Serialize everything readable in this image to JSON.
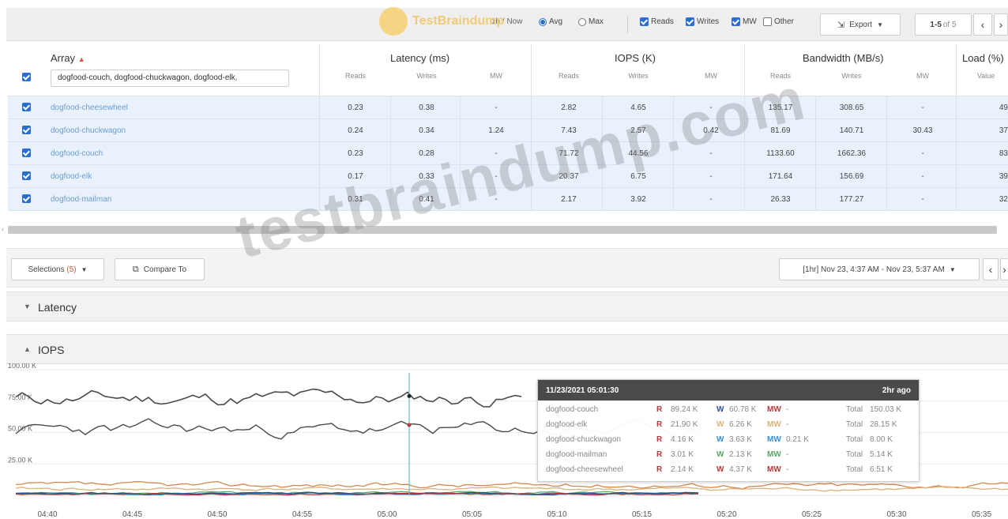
{
  "toolbar": {
    "left_partial": "1h / Now",
    "avg_label": "Avg",
    "max_label": "Max",
    "reads_label": "Reads",
    "writes_label": "Writes",
    "mw_label": "MW",
    "other_label": "Other",
    "export_label": "Export",
    "pagination_range": "1-5",
    "pagination_of": "of 5"
  },
  "watermark_logo_text": "TestBraindump",
  "table": {
    "array_header": "Array",
    "latency_header": "Latency (ms)",
    "iops_header": "IOPS (K)",
    "bandwidth_header": "Bandwidth (MB/s)",
    "load_header": "Load (%)",
    "sub_reads": "Reads",
    "sub_writes": "Writes",
    "sub_mw": "MW",
    "sub_value": "Value",
    "filter_value": "dogfood-couch, dogfood-chuckwagon, dogfood-elk,",
    "rows": [
      {
        "name": "dogfood-cheesewheel",
        "lat_r": "0.23",
        "lat_w": "0.38",
        "lat_mw": "-",
        "iops_r": "2.82",
        "iops_w": "4.65",
        "iops_mw": "-",
        "bw_r": "135.17",
        "bw_w": "308.65",
        "bw_mw": "-",
        "load": "49"
      },
      {
        "name": "dogfood-chuckwagon",
        "lat_r": "0.24",
        "lat_w": "0.34",
        "lat_mw": "1.24",
        "iops_r": "7.43",
        "iops_w": "2.57",
        "iops_mw": "0.42",
        "bw_r": "81.69",
        "bw_w": "140.71",
        "bw_mw": "30.43",
        "load": "37"
      },
      {
        "name": "dogfood-couch",
        "lat_r": "0.23",
        "lat_w": "0.28",
        "lat_mw": "-",
        "iops_r": "71.72",
        "iops_w": "44.56",
        "iops_mw": "-",
        "bw_r": "1133.60",
        "bw_w": "1662.36",
        "bw_mw": "-",
        "load": "83"
      },
      {
        "name": "dogfood-elk",
        "lat_r": "0.17",
        "lat_w": "0.33",
        "lat_mw": "-",
        "iops_r": "20.37",
        "iops_w": "6.75",
        "iops_mw": "-",
        "bw_r": "171.64",
        "bw_w": "156.69",
        "bw_mw": "-",
        "load": "39"
      },
      {
        "name": "dogfood-mailman",
        "lat_r": "0.31",
        "lat_w": "0.41",
        "lat_mw": "-",
        "iops_r": "2.17",
        "iops_w": "3.92",
        "iops_mw": "-",
        "bw_r": "26.33",
        "bw_w": "177.27",
        "bw_mw": "-",
        "load": "32"
      }
    ]
  },
  "scroll_left_glyph": "‹",
  "selection_bar": {
    "selections_label": "Selections",
    "selections_count": "(5)",
    "compare_label": "Compare To",
    "time_range": "[1hr] Nov 23, 4:37 AM - Nov 23, 5:37 AM"
  },
  "panels": {
    "latency_title": "Latency",
    "iops_title": "IOPS"
  },
  "watermark_text": "testbraindump.com",
  "tooltip": {
    "timestamp": "11/23/2021 05:01:30",
    "ago": "2hr ago",
    "rows": [
      {
        "name": "dogfood-couch",
        "r": "89.24 K",
        "w": "60.78 K",
        "mw": "-",
        "total": "150.03 K"
      },
      {
        "name": "dogfood-elk",
        "r": "21.90 K",
        "w": "6.26 K",
        "mw": "-",
        "total": "28.15 K"
      },
      {
        "name": "dogfood-chuckwagon",
        "r": "4.16 K",
        "w": "3.63 K",
        "mw": "0.21 K",
        "total": "8.00 K"
      },
      {
        "name": "dogfood-mailman",
        "r": "3.01 K",
        "w": "2.13 K",
        "mw": "-",
        "total": "5.14 K"
      },
      {
        "name": "dogfood-cheesewheel",
        "r": "2.14 K",
        "w": "4.37 K",
        "mw": "-",
        "total": "6.51 K"
      }
    ],
    "r_letter": "R",
    "w_letter": "W",
    "mw_letter": "MW",
    "total_label": "Total"
  },
  "chart_data": {
    "type": "line",
    "yticks": [
      "100.00 K",
      "75.00 K",
      "50.00 K",
      "25.00 K"
    ],
    "ytick_values": [
      100,
      75,
      50,
      25
    ],
    "xticks": [
      "04:40",
      "04:45",
      "04:50",
      "04:55",
      "05:00",
      "05:05",
      "05:10",
      "05:15",
      "05:20",
      "05:25",
      "05:30",
      "05:35"
    ],
    "ylim": [
      0,
      100
    ],
    "cursor_x": "05:01:30",
    "grid": true,
    "colors": {
      "dark": "#4a4a4a",
      "orange": "#d9864a",
      "tan": "#d8b27a",
      "green": "#5aa66a",
      "blue": "#3a8fd0",
      "red": "#b33a3a",
      "navy": "#2f4f8f",
      "cursor": "#6fb9c9"
    }
  }
}
